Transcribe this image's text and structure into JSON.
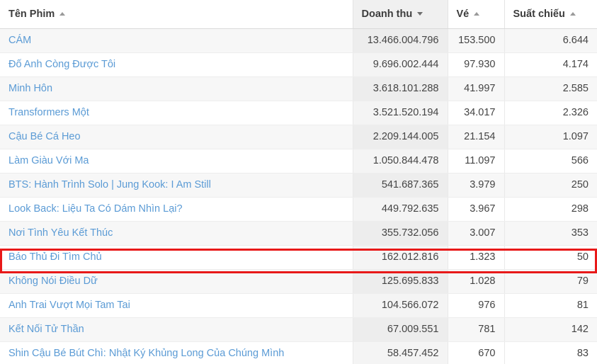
{
  "table": {
    "columns": [
      {
        "id": "name",
        "label": "Tên Phim",
        "sort": "asc",
        "active": false,
        "align": "left"
      },
      {
        "id": "rev",
        "label": "Doanh thu",
        "sort": "desc",
        "active": true,
        "align": "right"
      },
      {
        "id": "tick",
        "label": "Vé",
        "sort": "asc",
        "active": false,
        "align": "right"
      },
      {
        "id": "shows",
        "label": "Suất chiếu",
        "sort": "asc",
        "active": false,
        "align": "right"
      }
    ],
    "sort_icons": {
      "asc": "caret-up-icon",
      "desc": "caret-down-icon"
    },
    "accent_link_color": "#5b9bd5",
    "highlight_color": "#e81919",
    "highlighted_row_index": 8,
    "rows": [
      {
        "name": "CÁM",
        "revenue": "13.466.004.796",
        "tickets": "153.500",
        "showtimes": "6.644"
      },
      {
        "name": "Đố Anh Còng Được Tôi",
        "revenue": "9.696.002.444",
        "tickets": "97.930",
        "showtimes": "4.174"
      },
      {
        "name": "Minh Hôn",
        "revenue": "3.618.101.288",
        "tickets": "41.997",
        "showtimes": "2.585"
      },
      {
        "name": "Transformers Một",
        "revenue": "3.521.520.194",
        "tickets": "34.017",
        "showtimes": "2.326"
      },
      {
        "name": "Cậu Bé Cá Heo",
        "revenue": "2.209.144.005",
        "tickets": "21.154",
        "showtimes": "1.097"
      },
      {
        "name": "Làm Giàu Với Ma",
        "revenue": "1.050.844.478",
        "tickets": "11.097",
        "showtimes": "566"
      },
      {
        "name": "BTS: Hành Trình Solo | Jung Kook: I Am Still",
        "revenue": "541.687.365",
        "tickets": "3.979",
        "showtimes": "250"
      },
      {
        "name": "Look Back: Liệu Ta Có Dám Nhìn Lại?",
        "revenue": "449.792.635",
        "tickets": "3.967",
        "showtimes": "298"
      },
      {
        "name": "Nơi Tình Yêu Kết Thúc",
        "revenue": "355.732.056",
        "tickets": "3.007",
        "showtimes": "353"
      },
      {
        "name": "Báo Thủ Đi Tìm Chủ",
        "revenue": "162.012.816",
        "tickets": "1.323",
        "showtimes": "50"
      },
      {
        "name": "Không Nói Điều Dữ",
        "revenue": "125.695.833",
        "tickets": "1.028",
        "showtimes": "79"
      },
      {
        "name": "Anh Trai Vượt Mọi Tam Tai",
        "revenue": "104.566.072",
        "tickets": "976",
        "showtimes": "81"
      },
      {
        "name": "Kết Nối Tử Thần",
        "revenue": "67.009.551",
        "tickets": "781",
        "showtimes": "142"
      },
      {
        "name": "Shin Cậu Bé Bút Chì: Nhật Ký Khủng Long Của Chúng Mình",
        "revenue": "58.457.452",
        "tickets": "670",
        "showtimes": "83"
      }
    ]
  }
}
